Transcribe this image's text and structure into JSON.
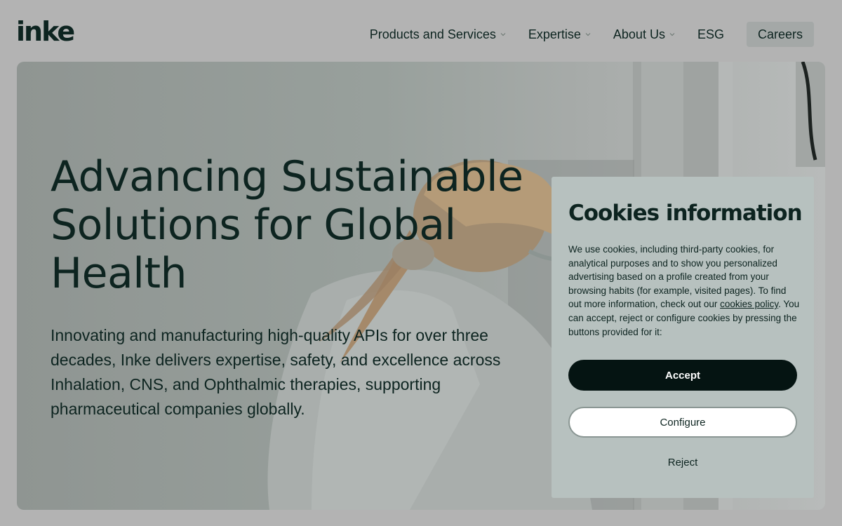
{
  "brand": {
    "logo_text": "inke"
  },
  "nav": {
    "items": [
      {
        "label": "Products and Services",
        "has_dropdown": true
      },
      {
        "label": "Expertise",
        "has_dropdown": true
      },
      {
        "label": "About Us",
        "has_dropdown": true
      },
      {
        "label": "ESG",
        "has_dropdown": false
      }
    ],
    "careers_label": "Careers"
  },
  "hero": {
    "title": "Advancing Sustainable Solutions for Global Health",
    "subtitle": "Innovating and manufacturing high-quality APIs for over three decades, Inke delivers expertise, safety, and excellence across Inhalation, CNS, and Ophthalmic therapies, supporting pharmaceutical companies globally."
  },
  "cookies": {
    "title": "Cookies information",
    "text_before_link": "We use cookies, including third-party cookies, for analytical purposes and to show you personalized advertising based on a profile created from your browsing habits (for example, visited pages). To find out more information, check out our ",
    "link_text": "cookies policy",
    "text_after_link": ". You can accept, reject or configure cookies by pressing the buttons provided for it:",
    "accept_label": "Accept",
    "configure_label": "Configure",
    "reject_label": "Reject"
  },
  "colors": {
    "brand_dark": "#0d2420",
    "accept_bg": "#051412",
    "dialog_bg": "#b7c1bf",
    "page_bg": "#b3b3b3"
  }
}
